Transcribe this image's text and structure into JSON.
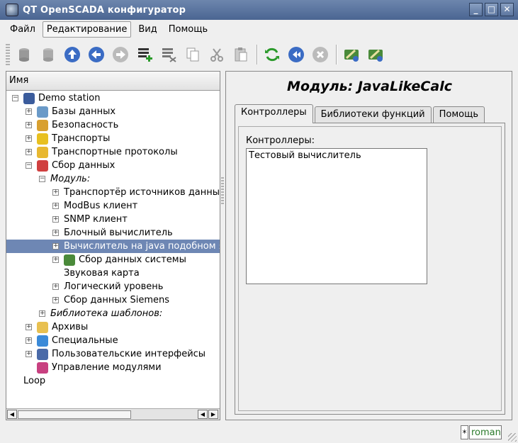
{
  "window": {
    "title": "QT OpenSCADA конфигуратор",
    "controls": [
      "_",
      "□",
      "✕"
    ]
  },
  "menu": [
    "Файл",
    "Редактирование",
    "Вид",
    "Помощь"
  ],
  "tree": {
    "header": "Имя",
    "items": [
      {
        "label": "Demo station",
        "indent": 0,
        "exp": "-",
        "icon": "station"
      },
      {
        "label": "Базы данных",
        "indent": 1,
        "exp": "+",
        "icon": "db"
      },
      {
        "label": "Безопасность",
        "indent": 1,
        "exp": "+",
        "icon": "users"
      },
      {
        "label": "Транспорты",
        "indent": 1,
        "exp": "+",
        "icon": "bolt"
      },
      {
        "label": "Транспортные протоколы",
        "indent": 1,
        "exp": "+",
        "icon": "folder"
      },
      {
        "label": "Сбор данных",
        "indent": 1,
        "exp": "-",
        "icon": "chart"
      },
      {
        "label": "Модуль:",
        "indent": 2,
        "exp": "-",
        "italic": true
      },
      {
        "label": "Транспортёр источников данных",
        "indent": 3,
        "exp": "+"
      },
      {
        "label": "ModBus клиент",
        "indent": 3,
        "exp": "+"
      },
      {
        "label": "SNMP клиент",
        "indent": 3,
        "exp": "+"
      },
      {
        "label": "Блочный вычислитель",
        "indent": 3,
        "exp": "+"
      },
      {
        "label": "Вычислитель на java подобном языке",
        "indent": 3,
        "exp": "+",
        "selected": true
      },
      {
        "label": "Сбор данных системы",
        "indent": 3,
        "exp": "+",
        "icon": "sys"
      },
      {
        "label": "Звуковая карта",
        "indent": 3,
        "exp": ""
      },
      {
        "label": "Логический уровень",
        "indent": 3,
        "exp": "+"
      },
      {
        "label": "Сбор данных Siemens",
        "indent": 3,
        "exp": "+"
      },
      {
        "label": "Библиотека шаблонов:",
        "indent": 2,
        "exp": "+",
        "italic": true
      },
      {
        "label": "Архивы",
        "indent": 1,
        "exp": "+",
        "icon": "box"
      },
      {
        "label": "Специальные",
        "indent": 1,
        "exp": "+",
        "icon": "help"
      },
      {
        "label": "Пользовательские интерфейсы",
        "indent": 1,
        "exp": "+",
        "icon": "monitor"
      },
      {
        "label": "Управление модулями",
        "indent": 1,
        "exp": "",
        "icon": "modules"
      },
      {
        "label": "Loop",
        "indent": 0,
        "exp": ""
      }
    ]
  },
  "right": {
    "title": "Модуль: JavaLikeCalc",
    "tabs": [
      "Контроллеры",
      "Библиотеки функций",
      "Помощь"
    ],
    "field_label": "Контроллеры:",
    "list": [
      "Тестовый вычислитель"
    ]
  },
  "status": {
    "marker": "*",
    "user": "roman"
  },
  "colors": {
    "title_bg": "#5a7299",
    "selection": "#6e87b4",
    "status_user": "#2a7a2a"
  }
}
